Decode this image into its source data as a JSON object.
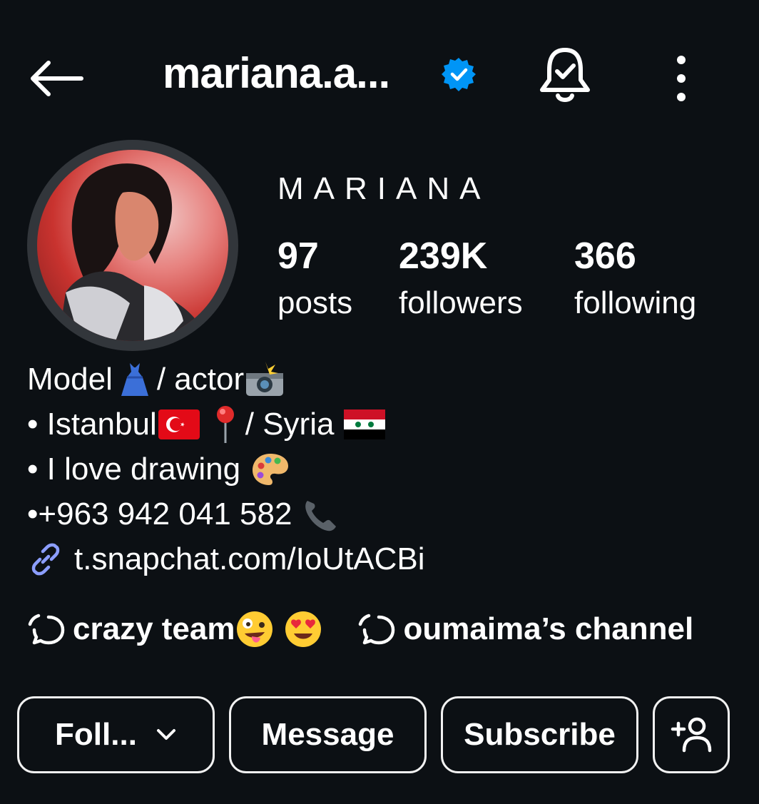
{
  "header": {
    "username": "mariana.a...",
    "icons": {
      "back": "arrow-left-icon",
      "verified": "verified-badge-icon",
      "notifications": "bell-check-icon",
      "more": "more-vertical-icon"
    }
  },
  "profile": {
    "display_name": "MARIANA",
    "stats": [
      {
        "value": "97",
        "label": "posts"
      },
      {
        "value": "239K",
        "label": "followers"
      },
      {
        "value": "366",
        "label": "following"
      }
    ]
  },
  "bio": {
    "line1_text": "Model",
    "line1_mid": "/ actor",
    "line2_text": "• Istanbul",
    "line2_mid": "/ Syria",
    "line3_text": "• I love drawing",
    "line4_text": "•+963 942 041 582",
    "link": "t.snapchat.com/IoUtACBi"
  },
  "channels": [
    {
      "name": "crazy team"
    },
    {
      "name": "oumaima’s channel"
    }
  ],
  "actions": {
    "follow": "Foll...",
    "message": "Message",
    "subscribe": "Subscribe"
  },
  "colors": {
    "background": "#0c1014",
    "verified": "#0095f6",
    "link_icon": "#8c9eff"
  }
}
